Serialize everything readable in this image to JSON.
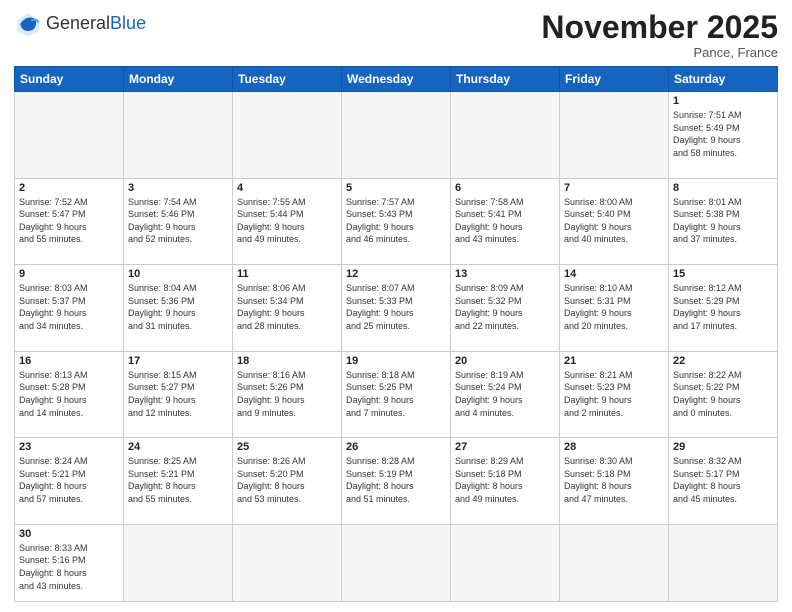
{
  "header": {
    "logo_general": "General",
    "logo_blue": "Blue",
    "month_title": "November 2025",
    "subtitle": "Pance, France"
  },
  "weekdays": [
    "Sunday",
    "Monday",
    "Tuesday",
    "Wednesday",
    "Thursday",
    "Friday",
    "Saturday"
  ],
  "rows": [
    [
      {
        "day": "",
        "empty": true,
        "lines": []
      },
      {
        "day": "",
        "empty": true,
        "lines": []
      },
      {
        "day": "",
        "empty": true,
        "lines": []
      },
      {
        "day": "",
        "empty": true,
        "lines": []
      },
      {
        "day": "",
        "empty": true,
        "lines": []
      },
      {
        "day": "",
        "empty": true,
        "lines": []
      },
      {
        "day": "1",
        "empty": false,
        "lines": [
          "Sunrise: 7:51 AM",
          "Sunset: 5:49 PM",
          "Daylight: 9 hours",
          "and 58 minutes."
        ]
      }
    ],
    [
      {
        "day": "2",
        "empty": false,
        "lines": [
          "Sunrise: 7:52 AM",
          "Sunset: 5:47 PM",
          "Daylight: 9 hours",
          "and 55 minutes."
        ]
      },
      {
        "day": "3",
        "empty": false,
        "lines": [
          "Sunrise: 7:54 AM",
          "Sunset: 5:46 PM",
          "Daylight: 9 hours",
          "and 52 minutes."
        ]
      },
      {
        "day": "4",
        "empty": false,
        "lines": [
          "Sunrise: 7:55 AM",
          "Sunset: 5:44 PM",
          "Daylight: 9 hours",
          "and 49 minutes."
        ]
      },
      {
        "day": "5",
        "empty": false,
        "lines": [
          "Sunrise: 7:57 AM",
          "Sunset: 5:43 PM",
          "Daylight: 9 hours",
          "and 46 minutes."
        ]
      },
      {
        "day": "6",
        "empty": false,
        "lines": [
          "Sunrise: 7:58 AM",
          "Sunset: 5:41 PM",
          "Daylight: 9 hours",
          "and 43 minutes."
        ]
      },
      {
        "day": "7",
        "empty": false,
        "lines": [
          "Sunrise: 8:00 AM",
          "Sunset: 5:40 PM",
          "Daylight: 9 hours",
          "and 40 minutes."
        ]
      },
      {
        "day": "8",
        "empty": false,
        "lines": [
          "Sunrise: 8:01 AM",
          "Sunset: 5:38 PM",
          "Daylight: 9 hours",
          "and 37 minutes."
        ]
      }
    ],
    [
      {
        "day": "9",
        "empty": false,
        "lines": [
          "Sunrise: 8:03 AM",
          "Sunset: 5:37 PM",
          "Daylight: 9 hours",
          "and 34 minutes."
        ]
      },
      {
        "day": "10",
        "empty": false,
        "lines": [
          "Sunrise: 8:04 AM",
          "Sunset: 5:36 PM",
          "Daylight: 9 hours",
          "and 31 minutes."
        ]
      },
      {
        "day": "11",
        "empty": false,
        "lines": [
          "Sunrise: 8:06 AM",
          "Sunset: 5:34 PM",
          "Daylight: 9 hours",
          "and 28 minutes."
        ]
      },
      {
        "day": "12",
        "empty": false,
        "lines": [
          "Sunrise: 8:07 AM",
          "Sunset: 5:33 PM",
          "Daylight: 9 hours",
          "and 25 minutes."
        ]
      },
      {
        "day": "13",
        "empty": false,
        "lines": [
          "Sunrise: 8:09 AM",
          "Sunset: 5:32 PM",
          "Daylight: 9 hours",
          "and 22 minutes."
        ]
      },
      {
        "day": "14",
        "empty": false,
        "lines": [
          "Sunrise: 8:10 AM",
          "Sunset: 5:31 PM",
          "Daylight: 9 hours",
          "and 20 minutes."
        ]
      },
      {
        "day": "15",
        "empty": false,
        "lines": [
          "Sunrise: 8:12 AM",
          "Sunset: 5:29 PM",
          "Daylight: 9 hours",
          "and 17 minutes."
        ]
      }
    ],
    [
      {
        "day": "16",
        "empty": false,
        "lines": [
          "Sunrise: 8:13 AM",
          "Sunset: 5:28 PM",
          "Daylight: 9 hours",
          "and 14 minutes."
        ]
      },
      {
        "day": "17",
        "empty": false,
        "lines": [
          "Sunrise: 8:15 AM",
          "Sunset: 5:27 PM",
          "Daylight: 9 hours",
          "and 12 minutes."
        ]
      },
      {
        "day": "18",
        "empty": false,
        "lines": [
          "Sunrise: 8:16 AM",
          "Sunset: 5:26 PM",
          "Daylight: 9 hours",
          "and 9 minutes."
        ]
      },
      {
        "day": "19",
        "empty": false,
        "lines": [
          "Sunrise: 8:18 AM",
          "Sunset: 5:25 PM",
          "Daylight: 9 hours",
          "and 7 minutes."
        ]
      },
      {
        "day": "20",
        "empty": false,
        "lines": [
          "Sunrise: 8:19 AM",
          "Sunset: 5:24 PM",
          "Daylight: 9 hours",
          "and 4 minutes."
        ]
      },
      {
        "day": "21",
        "empty": false,
        "lines": [
          "Sunrise: 8:21 AM",
          "Sunset: 5:23 PM",
          "Daylight: 9 hours",
          "and 2 minutes."
        ]
      },
      {
        "day": "22",
        "empty": false,
        "lines": [
          "Sunrise: 8:22 AM",
          "Sunset: 5:22 PM",
          "Daylight: 9 hours",
          "and 0 minutes."
        ]
      }
    ],
    [
      {
        "day": "23",
        "empty": false,
        "lines": [
          "Sunrise: 8:24 AM",
          "Sunset: 5:21 PM",
          "Daylight: 8 hours",
          "and 57 minutes."
        ]
      },
      {
        "day": "24",
        "empty": false,
        "lines": [
          "Sunrise: 8:25 AM",
          "Sunset: 5:21 PM",
          "Daylight: 8 hours",
          "and 55 minutes."
        ]
      },
      {
        "day": "25",
        "empty": false,
        "lines": [
          "Sunrise: 8:26 AM",
          "Sunset: 5:20 PM",
          "Daylight: 8 hours",
          "and 53 minutes."
        ]
      },
      {
        "day": "26",
        "empty": false,
        "lines": [
          "Sunrise: 8:28 AM",
          "Sunset: 5:19 PM",
          "Daylight: 8 hours",
          "and 51 minutes."
        ]
      },
      {
        "day": "27",
        "empty": false,
        "lines": [
          "Sunrise: 8:29 AM",
          "Sunset: 5:18 PM",
          "Daylight: 8 hours",
          "and 49 minutes."
        ]
      },
      {
        "day": "28",
        "empty": false,
        "lines": [
          "Sunrise: 8:30 AM",
          "Sunset: 5:18 PM",
          "Daylight: 8 hours",
          "and 47 minutes."
        ]
      },
      {
        "day": "29",
        "empty": false,
        "lines": [
          "Sunrise: 8:32 AM",
          "Sunset: 5:17 PM",
          "Daylight: 8 hours",
          "and 45 minutes."
        ]
      }
    ],
    [
      {
        "day": "30",
        "empty": false,
        "lines": [
          "Sunrise: 8:33 AM",
          "Sunset: 5:16 PM",
          "Daylight: 8 hours",
          "and 43 minutes."
        ]
      },
      {
        "day": "",
        "empty": true,
        "lines": []
      },
      {
        "day": "",
        "empty": true,
        "lines": []
      },
      {
        "day": "",
        "empty": true,
        "lines": []
      },
      {
        "day": "",
        "empty": true,
        "lines": []
      },
      {
        "day": "",
        "empty": true,
        "lines": []
      },
      {
        "day": "",
        "empty": true,
        "lines": []
      }
    ]
  ]
}
